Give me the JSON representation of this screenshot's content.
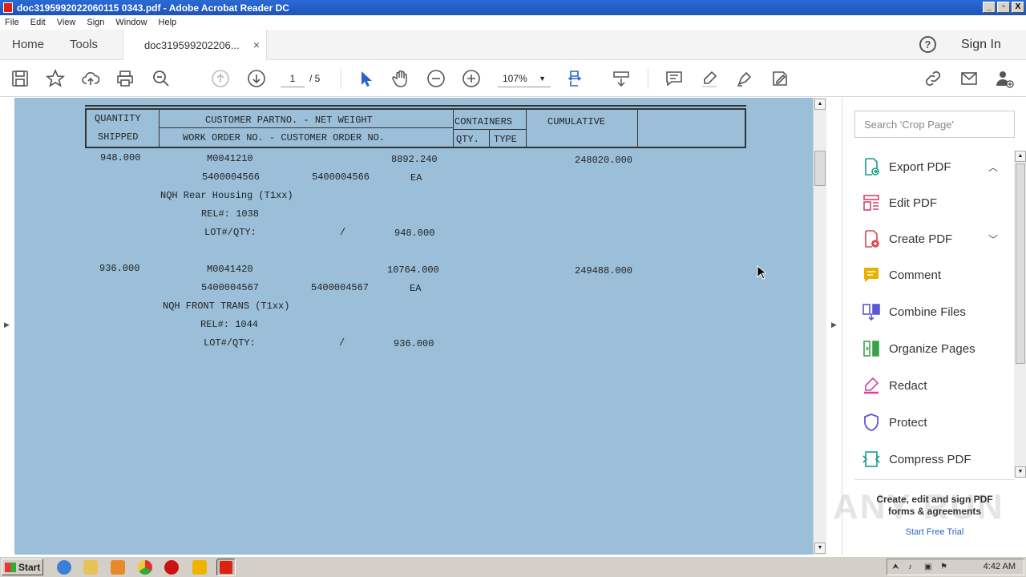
{
  "window": {
    "title": "doc3195992022060115 0343.pdf - Adobe Acrobat Reader DC",
    "btn_min": "_",
    "btn_max": "▫",
    "btn_close": "X"
  },
  "menu": [
    "File",
    "Edit",
    "View",
    "Sign",
    "Window",
    "Help"
  ],
  "tabs": {
    "home": "Home",
    "tools": "Tools",
    "doc": "doc319599202206...",
    "doc_close": "×",
    "help": "?",
    "signin": "Sign In"
  },
  "toolbar": {
    "page_current": "1",
    "page_total": "/ 5",
    "zoom": "107%",
    "zoom_caret": "▼"
  },
  "document": {
    "header": {
      "qty": "QUANTITY",
      "shipped": "SHIPPED",
      "partno": "CUSTOMER PARTNO. - NET WEIGHT",
      "workorder": "WORK ORDER NO. - CUSTOMER ORDER NO.",
      "containers": "CONTAINERS",
      "cqty": "QTY.",
      "ctype": "TYPE",
      "cumulative": "CUMULATIVE"
    },
    "items": [
      {
        "qty": "948.000",
        "part": "M0041210",
        "weight": "8892.240",
        "cumulative": "248020.000",
        "work_order": "5400004566",
        "cust_order": "5400004566",
        "unit": "EA",
        "desc": "NQH Rear Housing (T1xx)",
        "rel": "REL#: 1038",
        "lot_label": "LOT#/QTY:",
        "lot_slash": "/",
        "lot_qty": "948.000"
      },
      {
        "qty": "936.000",
        "part": "M0041420",
        "weight": "10764.000",
        "cumulative": "249488.000",
        "work_order": "5400004567",
        "cust_order": "5400004567",
        "unit": "EA",
        "desc": "NQH FRONT TRANS (T1xx)",
        "rel": "REL#: 1044",
        "lot_label": "LOT#/QTY:",
        "lot_slash": "/",
        "lot_qty": "936.000"
      }
    ]
  },
  "right_panel": {
    "search_placeholder": "Search 'Crop Page'",
    "tools": [
      {
        "label": "Export PDF",
        "icon": "export-pdf-icon",
        "color": "#1a9a8a",
        "chevron": "^"
      },
      {
        "label": "Edit PDF",
        "icon": "edit-pdf-icon",
        "color": "#d9406d",
        "chevron": ""
      },
      {
        "label": "Create PDF",
        "icon": "create-pdf-icon",
        "color": "#e0464a",
        "chevron": "v"
      },
      {
        "label": "Comment",
        "icon": "comment-icon",
        "color": "#e8b100",
        "chevron": ""
      },
      {
        "label": "Combine Files",
        "icon": "combine-files-icon",
        "color": "#5b58d6",
        "chevron": ""
      },
      {
        "label": "Organize Pages",
        "icon": "organize-pages-icon",
        "color": "#3aa34a",
        "chevron": ""
      },
      {
        "label": "Redact",
        "icon": "redact-icon",
        "color": "#d9409a",
        "chevron": ""
      },
      {
        "label": "Protect",
        "icon": "protect-icon",
        "color": "#5b58d6",
        "chevron": ""
      },
      {
        "label": "Compress PDF",
        "icon": "compress-pdf-icon",
        "color": "#1a9a8a",
        "chevron": ""
      }
    ],
    "promo": "Create, edit and sign PDF forms & agreements",
    "trial": "Start Free Trial",
    "watermark": "ANY RUN"
  },
  "taskbar": {
    "start": "Start",
    "clock": "4:42 AM"
  }
}
